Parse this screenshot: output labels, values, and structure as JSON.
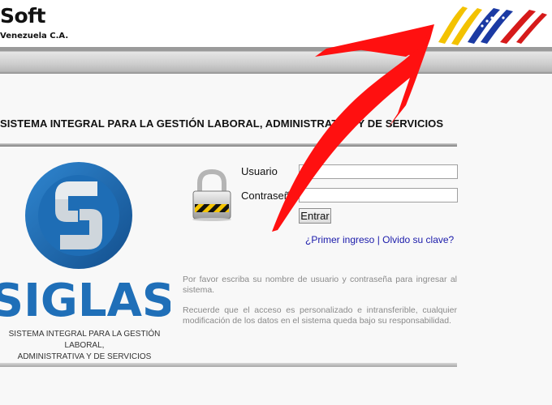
{
  "header": {
    "brand_name": "Soft",
    "brand_sub": "Venezuela C.A."
  },
  "page": {
    "title": "SISTEMA INTEGRAL PARA LA GESTIÓN LABORAL, ADMINISTRATIVA Y DE SERVICIOS"
  },
  "logo": {
    "word": "SIGLAS",
    "tagline_line1": "SISTEMA INTEGRAL PARA LA GESTIÓN LABORAL,",
    "tagline_line2": "ADMINISTRATIVA Y DE SERVICIOS"
  },
  "login": {
    "user_label": "Usuario",
    "pass_label": "Contraseña",
    "user_value": "",
    "pass_value": "",
    "submit_label": "Entrar",
    "first_login_link": "¿Primer ingreso",
    "separator": "|",
    "forgot_link": "Olvido su clave?"
  },
  "help": {
    "line1": "Por favor escriba su nombre de usuario y contraseña para ingresar al sistema.",
    "line2": "Recuerde que el acceso es personalizado e intransferible, cualquier modificación de los datos en el sistema queda bajo su responsabilidad."
  },
  "colors": {
    "link": "#1a1aaa",
    "logo_blue": "#1f6fb8",
    "annotation_arrow": "#ff0000"
  },
  "icons": [
    "padlock-icon",
    "venezuela-flag-logo",
    "siglas-logo",
    "red-annotation-arrow"
  ]
}
